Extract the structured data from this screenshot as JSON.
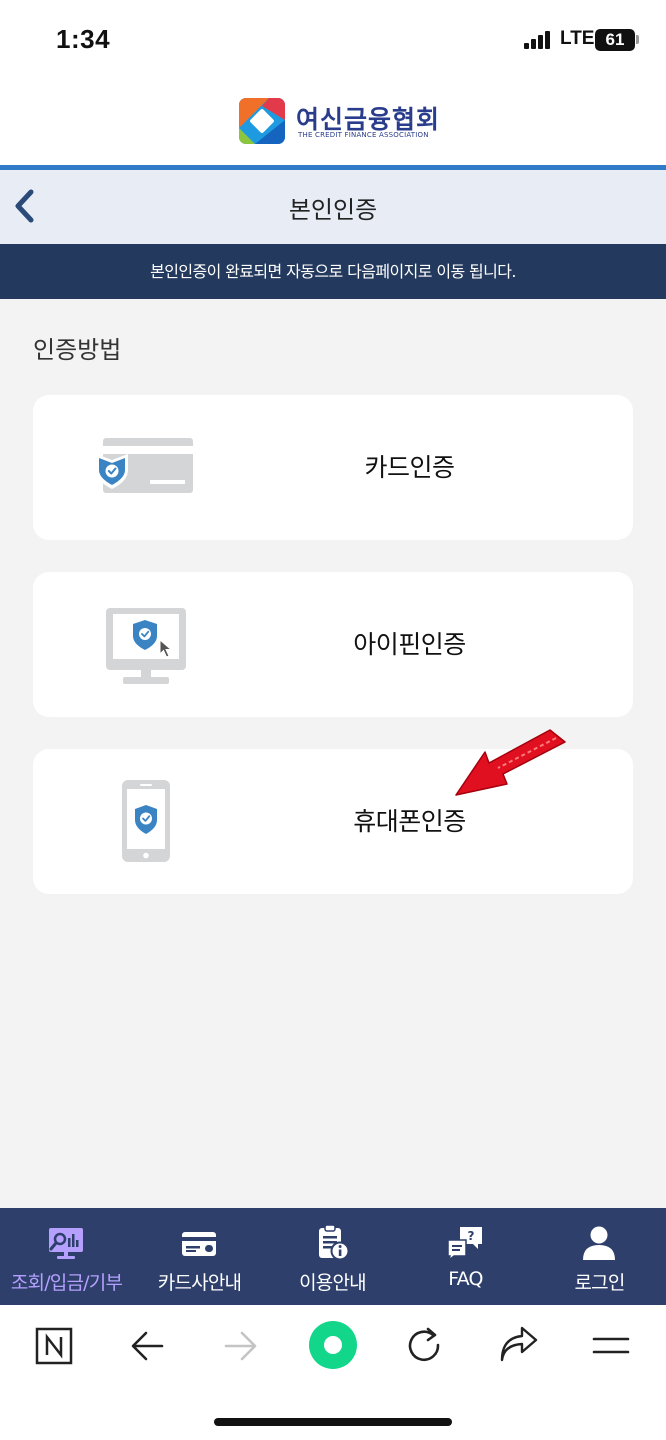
{
  "status_bar": {
    "time": "1:34",
    "network": "LTE",
    "battery": "61"
  },
  "header": {
    "logo_ko": "여신금융협회",
    "logo_en": "THE CREDIT FINANCE ASSOCIATION"
  },
  "title_bar": {
    "title": "본인인증",
    "back_icon": "chevron-left-icon"
  },
  "notice": {
    "text": "본인인증이 완료되면 자동으로 다음페이지로 이동 됩니다."
  },
  "main": {
    "section_title": "인증방법",
    "methods": [
      {
        "label": "카드인증",
        "icon": "card-shield-icon"
      },
      {
        "label": "아이핀인증",
        "icon": "monitor-shield-icon"
      },
      {
        "label": "휴대폰인증",
        "icon": "phone-shield-icon"
      }
    ],
    "annotation_icon": "red-arrow-icon"
  },
  "bottom_nav": {
    "items": [
      {
        "label": "조회/입금/기부",
        "icon": "chart-search-icon",
        "active": true
      },
      {
        "label": "카드사안내",
        "icon": "card-icon",
        "active": false
      },
      {
        "label": "이용안내",
        "icon": "clipboard-info-icon",
        "active": false
      },
      {
        "label": "FAQ",
        "icon": "faq-chat-icon",
        "active": false
      },
      {
        "label": "로그인",
        "icon": "user-icon",
        "active": false
      }
    ]
  },
  "browser_toolbar": {
    "buttons": [
      "naver-icon",
      "back-arrow-icon",
      "forward-arrow-icon",
      "green-dot-icon",
      "reload-icon",
      "share-icon",
      "menu-icon"
    ]
  },
  "colors": {
    "accent_blue": "#2f7bc7",
    "notice_bg": "#23395d",
    "nav_bg": "#2e3f6b",
    "active_nav": "#b5a0ff",
    "shield_blue": "#3a84c4",
    "arrow_red": "#e01020",
    "green_dot": "#12d68a"
  }
}
